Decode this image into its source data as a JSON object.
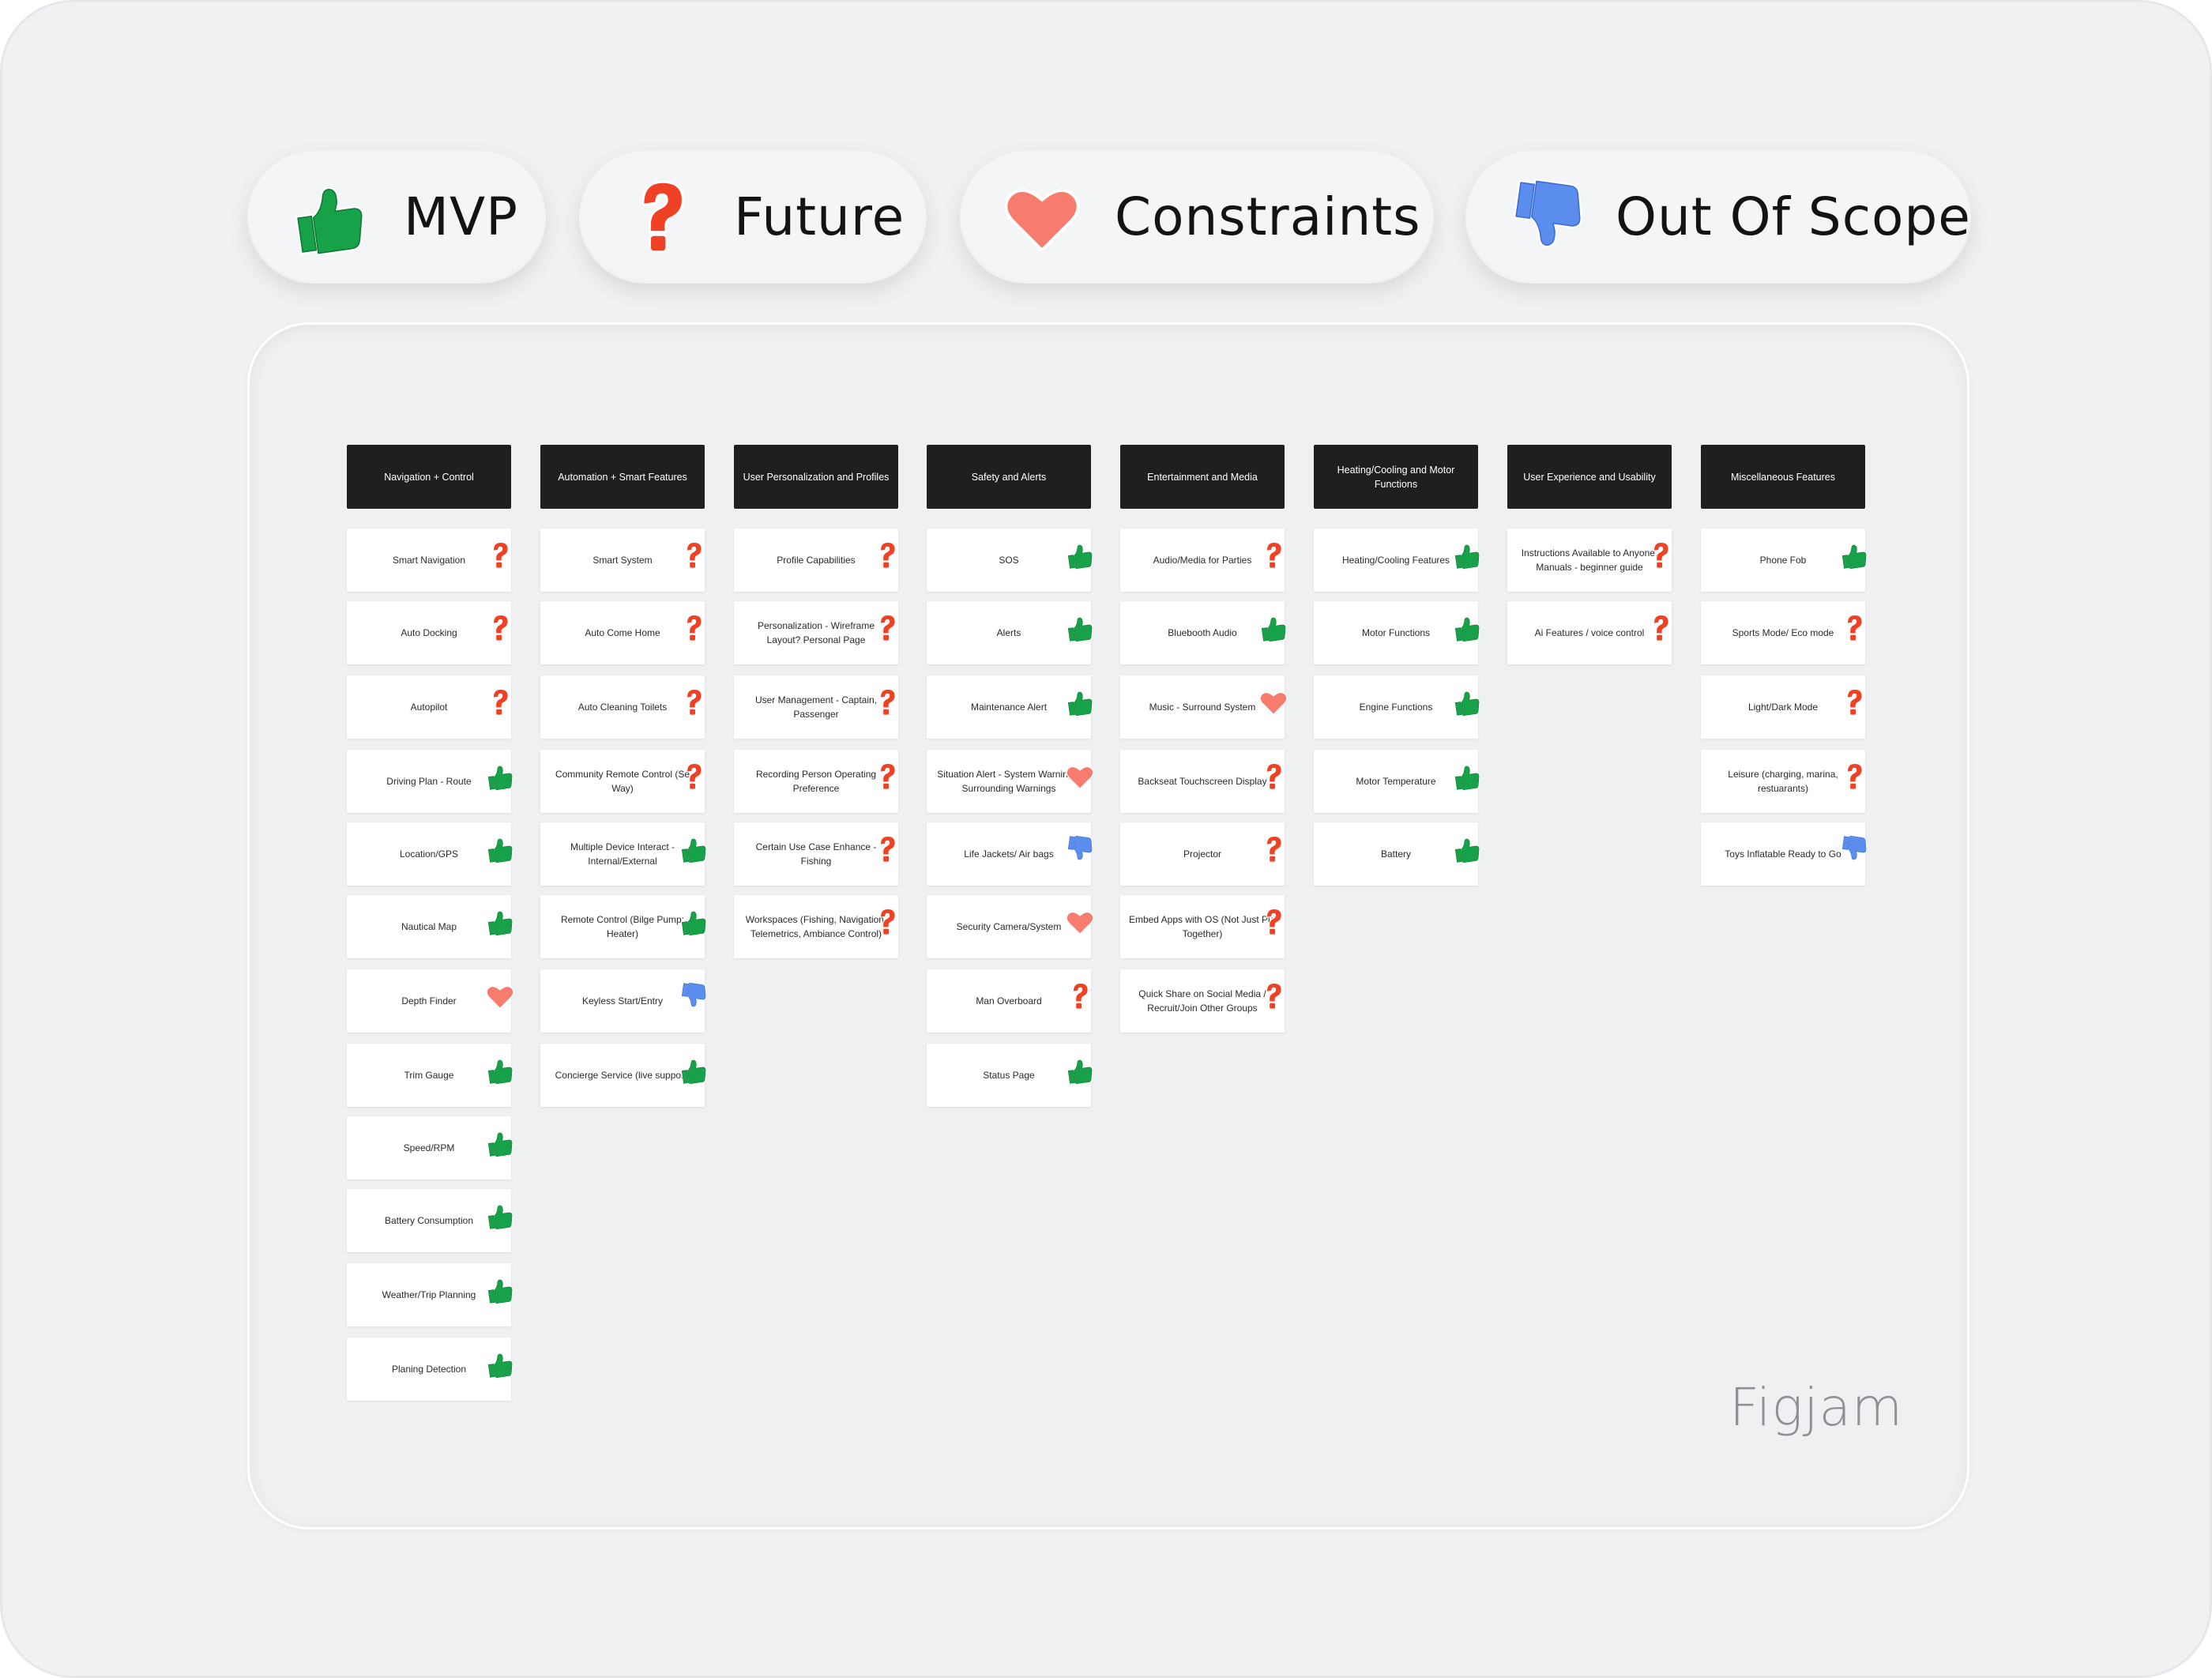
{
  "legend": {
    "mvp": {
      "label": "MVP",
      "icon": "thumbs-up-icon",
      "color": "#17a24a"
    },
    "future": {
      "label": "Future",
      "icon": "question-mark-icon",
      "color": "#ef4123"
    },
    "constraints": {
      "label": "Constraints",
      "icon": "heart-icon",
      "color": "#f87c6e"
    },
    "out_of_scope": {
      "label": "Out Of Scope",
      "icon": "thumbs-down-icon",
      "color": "#5b8def"
    }
  },
  "columns": [
    {
      "title": "Navigation + Control",
      "cards": [
        {
          "text": "Smart Navigation",
          "tag": "future"
        },
        {
          "text": "Auto Docking",
          "tag": "future"
        },
        {
          "text": "Autopilot",
          "tag": "future"
        },
        {
          "text": "Driving Plan - Route",
          "tag": "mvp"
        },
        {
          "text": "Location/GPS",
          "tag": "mvp"
        },
        {
          "text": "Nautical Map",
          "tag": "mvp"
        },
        {
          "text": "Depth Finder",
          "tag": "constraints"
        },
        {
          "text": "Trim Gauge",
          "tag": "mvp"
        },
        {
          "text": "Speed/RPM",
          "tag": "mvp"
        },
        {
          "text": "Battery Consumption",
          "tag": "mvp"
        },
        {
          "text": "Weather/Trip Planning",
          "tag": "mvp"
        },
        {
          "text": "Planing Detection",
          "tag": "mvp"
        }
      ]
    },
    {
      "title": "Automation + Smart Features",
      "cards": [
        {
          "text": "Smart System",
          "tag": "future"
        },
        {
          "text": "Auto Come Home",
          "tag": "future"
        },
        {
          "text": "Auto Cleaning Toilets",
          "tag": "future"
        },
        {
          "text": "Community Remote Control (Se Way)",
          "tag": "future"
        },
        {
          "text": "Multiple Device Interact - Internal/External",
          "tag": "mvp"
        },
        {
          "text": "Remote Control (Bilge Pump; Heater)",
          "tag": "mvp"
        },
        {
          "text": "Keyless Start/Entry",
          "tag": "out_of_scope"
        },
        {
          "text": "Concierge Service (live support)",
          "tag": "mvp"
        }
      ]
    },
    {
      "title": "User Personalization and Profiles",
      "cards": [
        {
          "text": "Profile Capabilities",
          "tag": "future"
        },
        {
          "text": "Personalization - Wireframe Layout? Personal Page",
          "tag": "future"
        },
        {
          "text": "User Management - Captain, Passenger",
          "tag": "future"
        },
        {
          "text": "Recording Person Operating Preference",
          "tag": "future"
        },
        {
          "text": "Certain Use Case Enhance - Fishing",
          "tag": "future"
        },
        {
          "text": "Workspaces (Fishing, Navigation, Telemetrics, Ambiance Control)",
          "tag": "future"
        }
      ]
    },
    {
      "title": "Safety and Alerts",
      "cards": [
        {
          "text": "SOS",
          "tag": "mvp"
        },
        {
          "text": "Alerts",
          "tag": "mvp"
        },
        {
          "text": "Maintenance Alert",
          "tag": "mvp"
        },
        {
          "text": "Situation Alert - System Warnings, Surrounding Warnings",
          "tag": "constraints"
        },
        {
          "text": "Life Jackets/ Air bags",
          "tag": "out_of_scope"
        },
        {
          "text": "Security Camera/System",
          "tag": "constraints"
        },
        {
          "text": "Man Overboard",
          "tag": "future"
        },
        {
          "text": "Status Page",
          "tag": "mvp"
        }
      ]
    },
    {
      "title": "Entertainment and Media",
      "cards": [
        {
          "text": "Audio/Media for Parties",
          "tag": "future"
        },
        {
          "text": "Bluebooth Audio",
          "tag": "mvp"
        },
        {
          "text": "Music - Surround System",
          "tag": "constraints"
        },
        {
          "text": "Backseat Touchscreen Display",
          "tag": "future"
        },
        {
          "text": "Projector",
          "tag": "future"
        },
        {
          "text": "Embed Apps with OS (Not Just Put Together)",
          "tag": "future"
        },
        {
          "text": "Quick Share on Social Media / Recruit/Join Other Groups",
          "tag": "future"
        }
      ]
    },
    {
      "title": "Heating/Cooling and Motor Functions",
      "cards": [
        {
          "text": "Heating/Cooling Features",
          "tag": "mvp"
        },
        {
          "text": "Motor Functions",
          "tag": "mvp"
        },
        {
          "text": "Engine Functions",
          "tag": "mvp"
        },
        {
          "text": "Motor Temperature",
          "tag": "mvp"
        },
        {
          "text": "Battery",
          "tag": "mvp"
        }
      ]
    },
    {
      "title": "User Experience and Usability",
      "cards": [
        {
          "text": "Instructions Available to Anyone, Manuals - beginner guide",
          "tag": "future"
        },
        {
          "text": "Ai Features / voice control",
          "tag": "future"
        }
      ]
    },
    {
      "title": "Miscellaneous Features",
      "cards": [
        {
          "text": "Phone Fob",
          "tag": "mvp"
        },
        {
          "text": "Sports Mode/ Eco mode",
          "tag": "future"
        },
        {
          "text": "Light/Dark Mode",
          "tag": "future"
        },
        {
          "text": "Leisure (charging, marina, restuarants)",
          "tag": "future"
        },
        {
          "text": "Toys Inflatable Ready to Go",
          "tag": "out_of_scope"
        }
      ]
    }
  ],
  "watermark": "Figjam"
}
